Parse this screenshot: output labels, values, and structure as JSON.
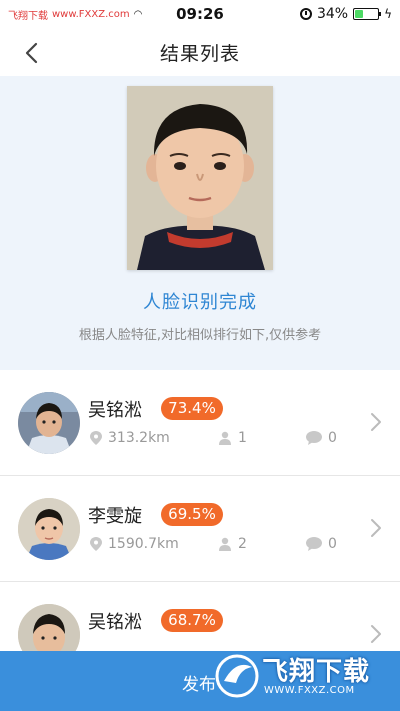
{
  "status_bar": {
    "carrier": "飞翔下载",
    "site": "www.FXXZ.com",
    "time": "09:26",
    "battery": "34%",
    "battery_level": 0.34
  },
  "nav": {
    "title": "结果列表"
  },
  "result": {
    "title": "人脸识别完成",
    "subtitle": "根据人脸特征,对比相似排行如下,仅供参考"
  },
  "list": [
    {
      "name": "吴铭淞",
      "score": "73.4%",
      "distance": "313.2km",
      "people": "1",
      "comments": "0"
    },
    {
      "name": "李雯旋",
      "score": "69.5%",
      "distance": "1590.7km",
      "people": "2",
      "comments": "0"
    },
    {
      "name": "吴铭淞",
      "score": "68.7%",
      "distance": "",
      "people": "",
      "comments": ""
    }
  ],
  "bottom": {
    "label": "发布"
  },
  "watermark": {
    "text": "飞翔下载",
    "url": "WWW.FXXZ.COM"
  },
  "colors": {
    "accent": "#2f86d3",
    "score_badge": "#f16a2a",
    "bottom_bar": "#3a8fdc"
  }
}
